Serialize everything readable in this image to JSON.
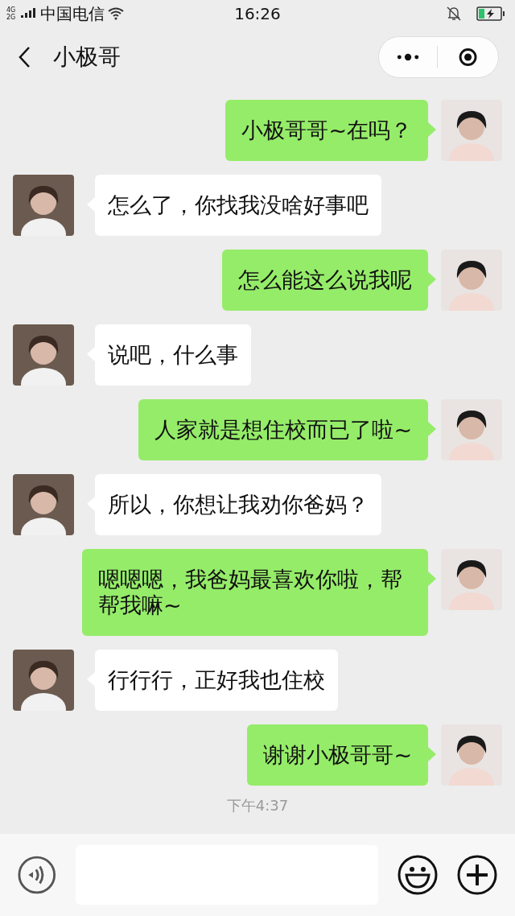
{
  "status_bar": {
    "network": "4G 2G",
    "carrier": "中国电信",
    "time": "16:26"
  },
  "header": {
    "title": "小极哥"
  },
  "messages": [
    {
      "kind": "sent",
      "text": "小极哥哥~在吗？"
    },
    {
      "kind": "received",
      "text": "怎么了，你找我没啥好事吧"
    },
    {
      "kind": "sent",
      "text": "怎么能这么说我呢"
    },
    {
      "kind": "received",
      "text": "说吧，什么事"
    },
    {
      "kind": "sent",
      "text": "人家就是想住校而已了啦~"
    },
    {
      "kind": "received",
      "text": "所以，你想让我劝你爸妈？"
    },
    {
      "kind": "sent",
      "text": "嗯嗯嗯，我爸妈最喜欢你啦，帮帮我嘛~"
    },
    {
      "kind": "received",
      "text": "行行行，正好我也住校"
    },
    {
      "kind": "sent",
      "text": "谢谢小极哥哥~"
    }
  ],
  "timestamp": "下午4:37"
}
